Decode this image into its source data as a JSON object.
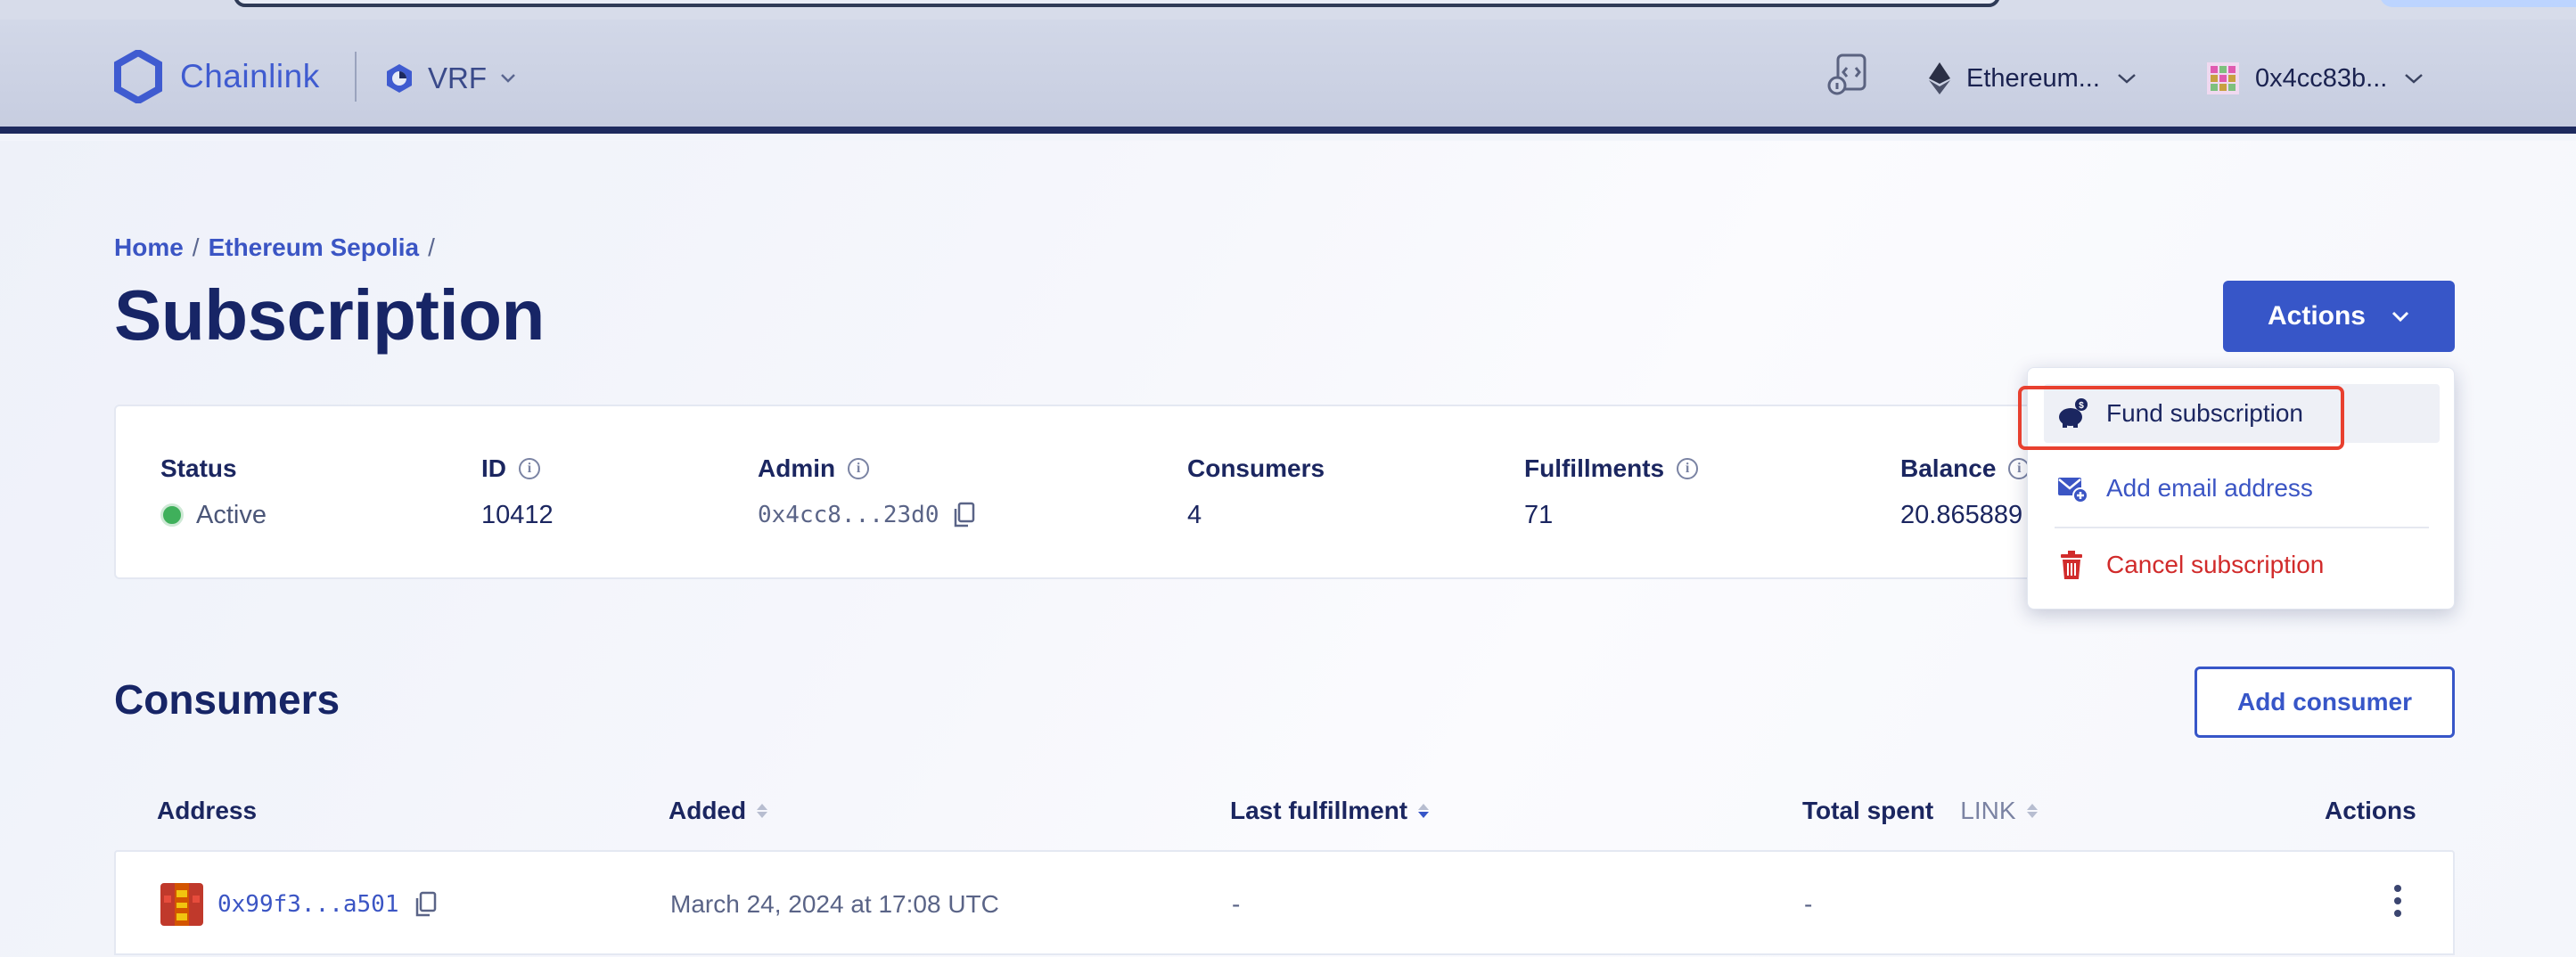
{
  "header": {
    "brand": "Chainlink",
    "product": "VRF",
    "network": "Ethereum...",
    "wallet": "0x4cc83b..."
  },
  "breadcrumb": {
    "home": "Home",
    "sep": "/",
    "network": "Ethereum Sepolia"
  },
  "page": {
    "title": "Subscription",
    "actions_label": "Actions"
  },
  "summary": {
    "status": {
      "label": "Status",
      "value": "Active"
    },
    "id": {
      "label": "ID",
      "value": "10412"
    },
    "admin": {
      "label": "Admin",
      "value": "0x4cc8...23d0"
    },
    "consumers": {
      "label": "Consumers",
      "value": "4"
    },
    "fulfillments": {
      "label": "Fulfillments",
      "value": "71"
    },
    "balance": {
      "label": "Balance",
      "value": "20.865889"
    }
  },
  "menu": {
    "items": [
      {
        "label": "Fund subscription",
        "icon": "piggy-bank-icon"
      },
      {
        "label": "Add email address",
        "icon": "mail-plus-icon"
      },
      {
        "label": "Cancel subscription",
        "icon": "trash-icon"
      }
    ]
  },
  "consumers": {
    "title": "Consumers",
    "add_label": "Add consumer",
    "columns": {
      "address": "Address",
      "added": "Added",
      "last_fulfillment": "Last fulfillment",
      "total_spent": "Total spent",
      "unit": "LINK",
      "actions": "Actions"
    },
    "rows": [
      {
        "address": "0x99f3...a501",
        "added": "March 24, 2024 at 17:08 UTC",
        "last_fulfillment": "-",
        "total_spent": "-"
      }
    ]
  },
  "colors": {
    "accent": "#3756c8",
    "status_active": "#3fb05b",
    "danger": "#d12b2b",
    "highlight_outline": "#e8402f"
  }
}
